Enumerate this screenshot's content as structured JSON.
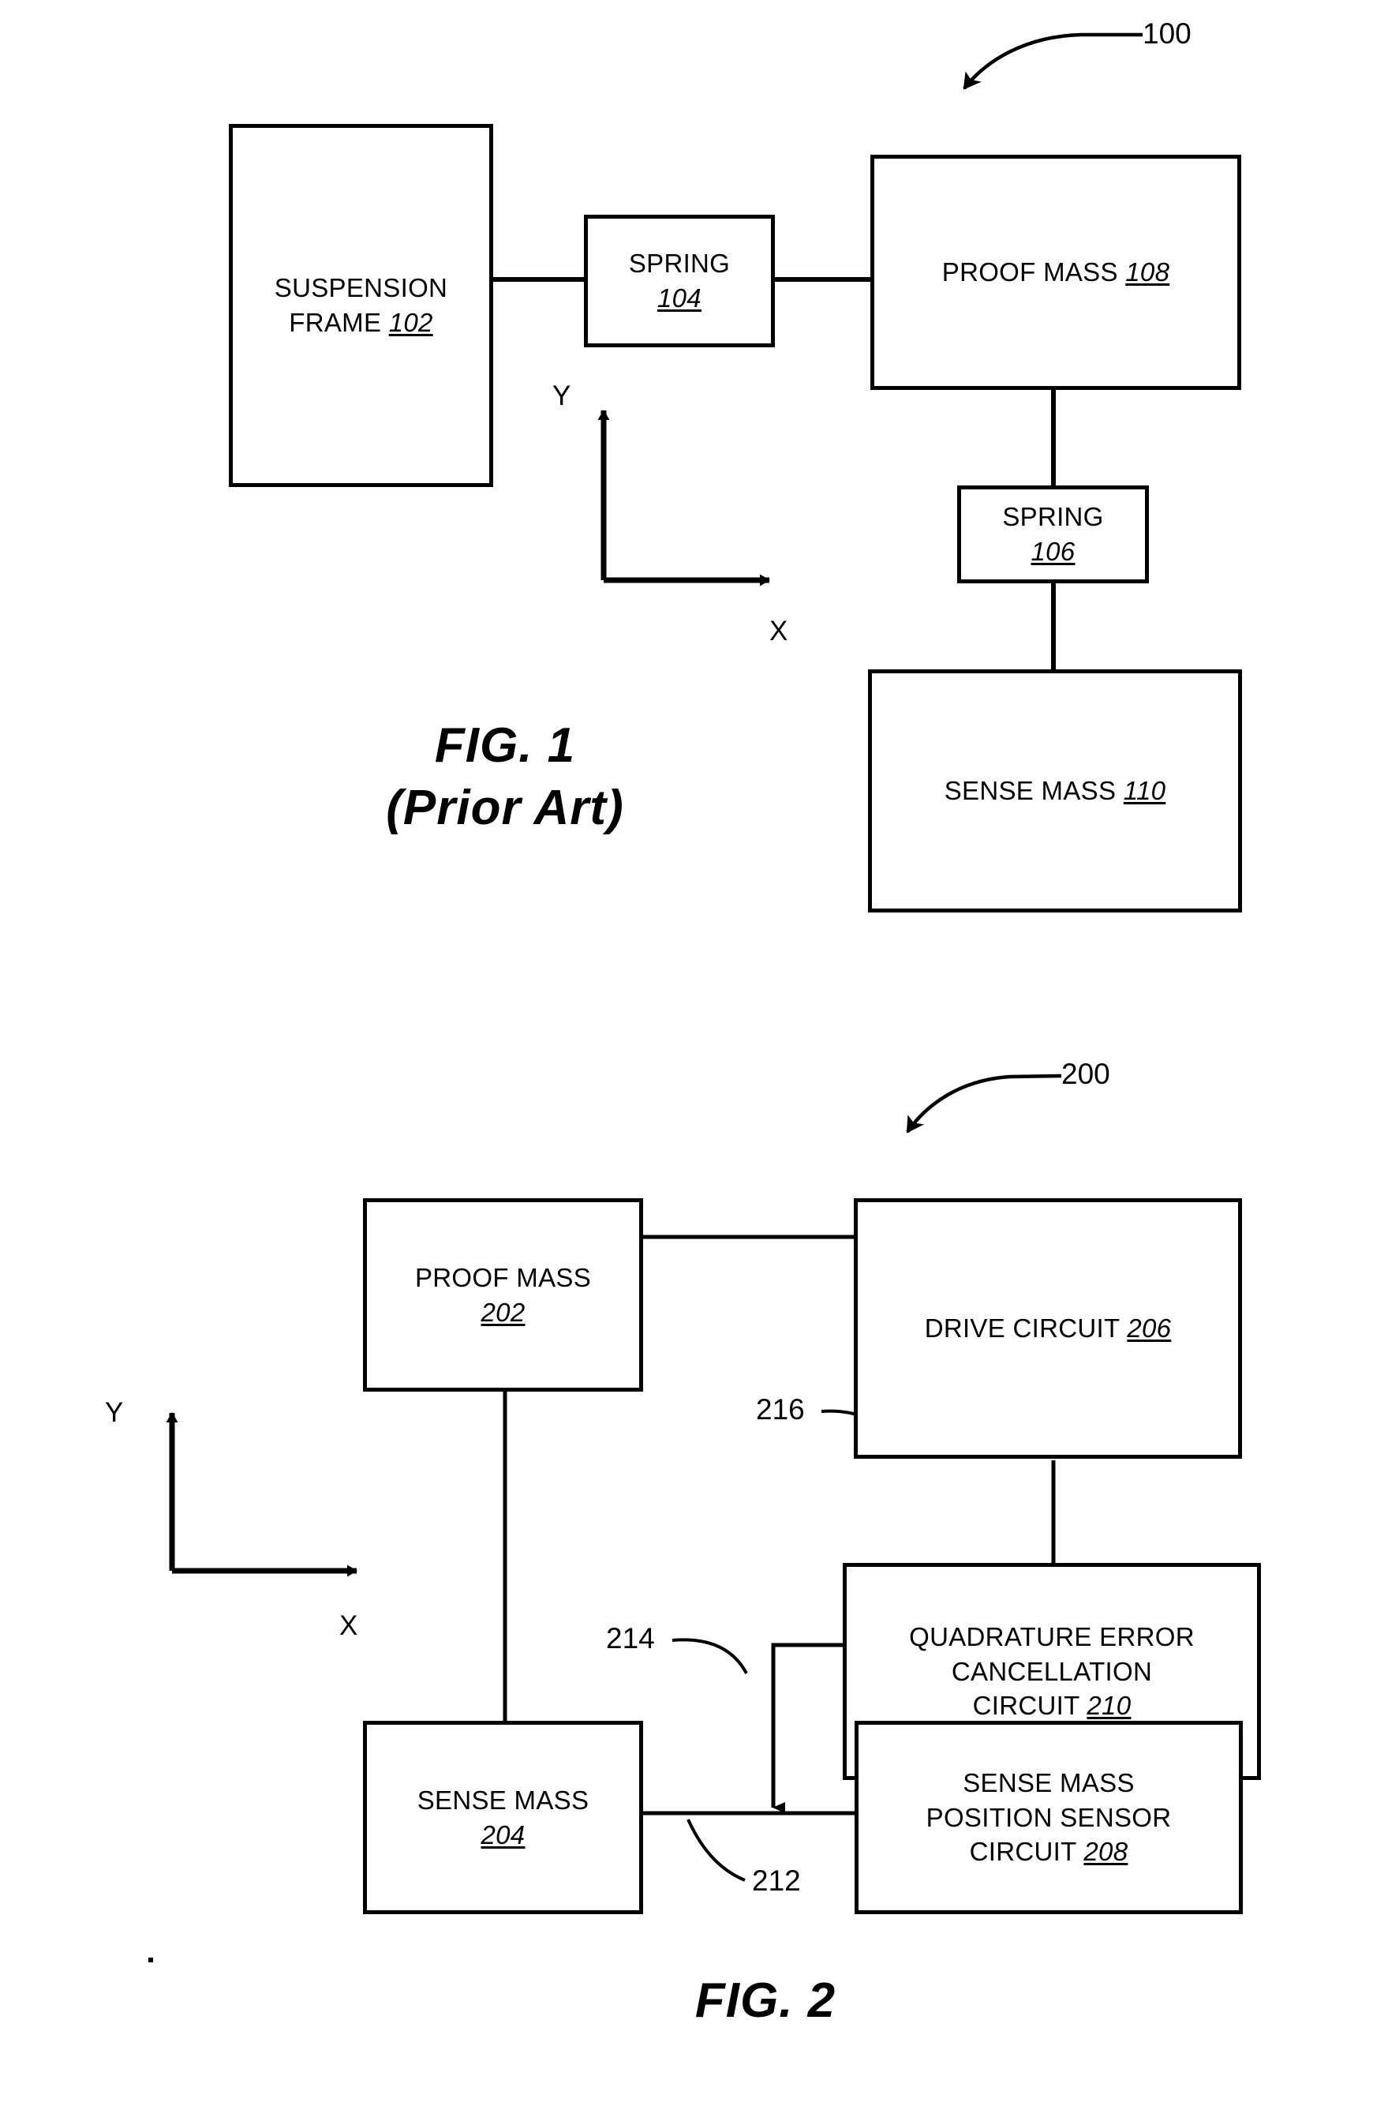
{
  "document": {
    "type": "patent-figure-sheet",
    "figures": [
      {
        "id": "fig1",
        "caption": "FIG. 1\n(Prior Art)",
        "reference_numeral": "100",
        "axes": {
          "y_label": "Y",
          "x_label": "X"
        },
        "nodes": [
          {
            "key": "suspension_frame",
            "text": "SUSPENSION\nFRAME ",
            "ref": "102"
          },
          {
            "key": "spring_104",
            "text": "SPRING\n",
            "ref": "104"
          },
          {
            "key": "proof_mass_108",
            "text": "PROOF MASS ",
            "ref": "108"
          },
          {
            "key": "spring_106",
            "text": "SPRING\n",
            "ref": "106"
          },
          {
            "key": "sense_mass_110",
            "text": "SENSE MASS ",
            "ref": "110"
          }
        ],
        "connections": [
          {
            "from": "suspension_frame",
            "to": "spring_104",
            "style": "line"
          },
          {
            "from": "spring_104",
            "to": "proof_mass_108",
            "style": "line"
          },
          {
            "from": "proof_mass_108",
            "to": "spring_106",
            "style": "line"
          },
          {
            "from": "spring_106",
            "to": "sense_mass_110",
            "style": "line"
          }
        ]
      },
      {
        "id": "fig2",
        "caption": "FIG. 2",
        "reference_numeral": "200",
        "axes": {
          "y_label": "Y",
          "x_label": "X"
        },
        "nodes": [
          {
            "key": "proof_mass_202",
            "text": "PROOF MASS\n",
            "ref": "202"
          },
          {
            "key": "drive_circuit_206",
            "text": "DRIVE CIRCUIT ",
            "ref": "206"
          },
          {
            "key": "quad_circuit_210",
            "text": "QUADRATURE ERROR\nCANCELLATION\nCIRCUIT ",
            "ref": "210"
          },
          {
            "key": "sense_mass_204",
            "text": "SENSE MASS\n",
            "ref": "204"
          },
          {
            "key": "sensor_circuit_208",
            "text": "SENSE MASS\nPOSITION SENSOR\nCIRCUIT ",
            "ref": "208"
          }
        ],
        "signal_labels": [
          {
            "key": "signal_216",
            "text": "216"
          },
          {
            "key": "signal_214",
            "text": "214"
          },
          {
            "key": "signal_212",
            "text": "212"
          }
        ],
        "connections": [
          {
            "from": "proof_mass_202",
            "to": "drive_circuit_206",
            "style": "line"
          },
          {
            "from": "proof_mass_202",
            "to": "sense_mass_204",
            "style": "line"
          },
          {
            "from": "drive_circuit_206",
            "to": "quad_circuit_210",
            "style": "line",
            "label": "216"
          },
          {
            "from": "quad_circuit_210",
            "to": "signal_212",
            "style": "arrow",
            "label": "214"
          },
          {
            "from": "sense_mass_204",
            "to": "sensor_circuit_208",
            "style": "line",
            "label": "212"
          }
        ]
      }
    ]
  },
  "colors": {
    "ink": "#000000",
    "paper": "#ffffff"
  }
}
